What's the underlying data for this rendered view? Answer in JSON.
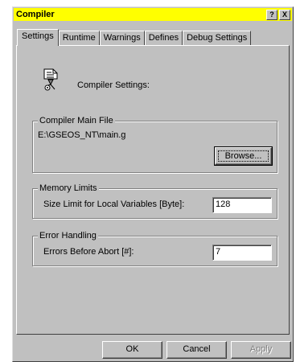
{
  "window": {
    "title": "Compiler",
    "help_label": "?",
    "close_label": "X"
  },
  "tabs": [
    "Settings",
    "Runtime",
    "Warnings",
    "Defines",
    "Debug Settings"
  ],
  "header": {
    "icon": "compiler-icon",
    "label": "Compiler Settings:"
  },
  "main_file": {
    "group_title": "Compiler Main File",
    "path": "E:\\GSEOS_NT\\main.g",
    "browse_label": "Browse..."
  },
  "memory": {
    "group_title": "Memory Limits",
    "label": "Size Limit for Local Variables [Byte]:",
    "value": "128"
  },
  "errors": {
    "group_title": "Error Handling",
    "label": "Errors Before Abort [#]:",
    "value": "7"
  },
  "footer": {
    "ok_label": "OK",
    "cancel_label": "Cancel",
    "apply_label": "Apply"
  }
}
